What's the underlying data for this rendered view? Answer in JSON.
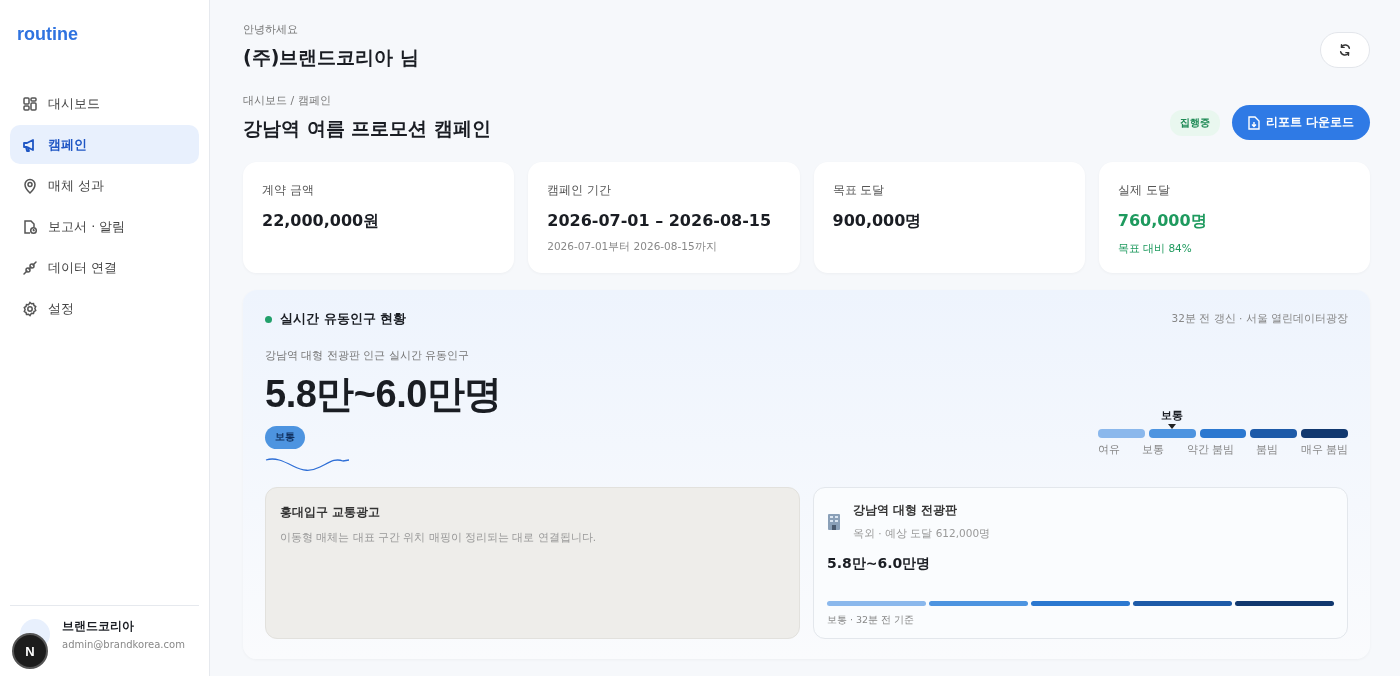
{
  "sidebar": {
    "logo": "routine",
    "items": [
      {
        "label": "대시보드",
        "selected": false
      },
      {
        "label": "캠페인",
        "selected": true
      },
      {
        "label": "매체 성과",
        "selected": false
      },
      {
        "label": "보고서 · 알림",
        "selected": false
      },
      {
        "label": "데이터 연결",
        "selected": false
      },
      {
        "label": "설정",
        "selected": false
      }
    ],
    "user": {
      "name": "브랜드코리아",
      "email": "admin@brandkorea.com"
    },
    "dev_badge": "N"
  },
  "header": {
    "greeting": "안녕하세요",
    "user_name": "(주)브랜드코리아 님"
  },
  "page": {
    "breadcrumb": "대시보드 / 캠페인",
    "title": "강남역 여름 프로모션 캠페인",
    "status": "집행중",
    "download_button": "리포트 다운로드"
  },
  "stats": [
    {
      "label": "계약 금액",
      "value": "22,000,000원",
      "highlight": false
    },
    {
      "label": "캠페인 기간",
      "value": "2026-07-01 – 2026-08-15",
      "note": "2026-07-01부터 2026-08-15까지",
      "highlight": false
    },
    {
      "label": "목표 도달",
      "value": "900,000명",
      "highlight": false
    },
    {
      "label": "실제 도달",
      "value": "760,000명",
      "note": "목표 대비 84%",
      "highlight": true
    }
  ],
  "live": {
    "title": "실시간 유동인구 현황",
    "source": "32분 전 갱신 · 서울 열린데이터광장",
    "subtitle": "강남역 대형 전광판 인근 실시간 유동인구",
    "value": "5.8만~6.0만명",
    "level_badge": "보통",
    "marker_label": "보통",
    "scale": [
      {
        "label": "여유",
        "color": "#8bb8ec",
        "selected": false
      },
      {
        "label": "보통",
        "color": "#4d94e0",
        "selected": true
      },
      {
        "label": "약간 붐빔",
        "color": "#2b78d0",
        "selected": false
      },
      {
        "label": "붐빔",
        "color": "#1d5aa8",
        "selected": false
      },
      {
        "label": "매우 붐빔",
        "color": "#11386f",
        "selected": false
      }
    ],
    "media": [
      {
        "kind": "placeholder",
        "title": "홍대입구 교통광고",
        "text": "이동형 매체는 대표 구간 위치 매핑이 정리되는 대로 연결됩니다."
      },
      {
        "kind": "detail",
        "title": "강남역 대형 전광판",
        "meta": "옥외 · 예상 도달 612,000명",
        "value": "5.8만~6.0만명",
        "footer": "보통 · 32분 전 기준"
      }
    ]
  }
}
